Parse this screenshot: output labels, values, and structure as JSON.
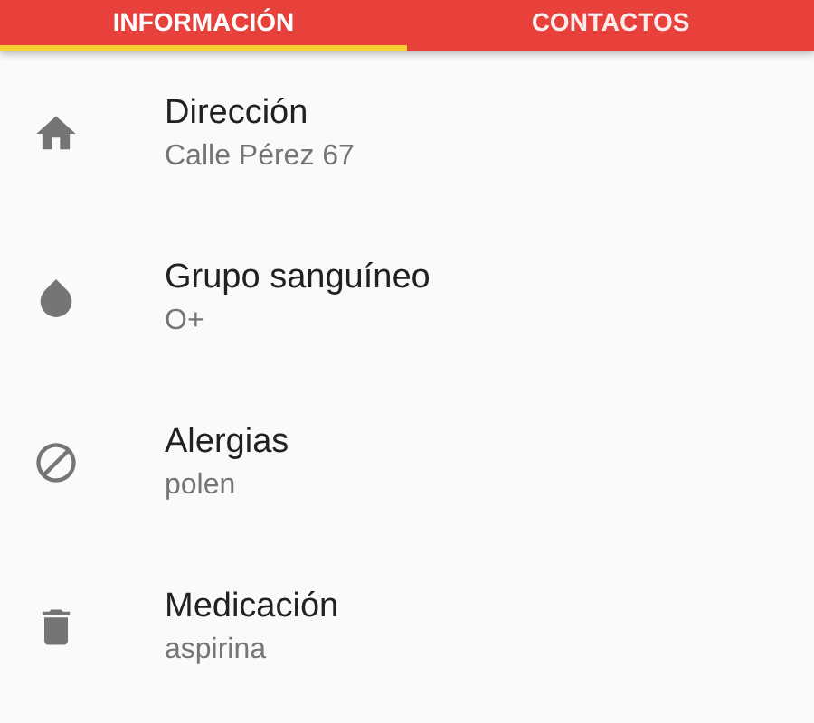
{
  "tabs": [
    {
      "label": "INFORMACIÓN",
      "selected": true
    },
    {
      "label": "CONTACTOS",
      "selected": false
    }
  ],
  "items": [
    {
      "kind": "home",
      "title": "Dirección",
      "value": "Calle Pérez 67"
    },
    {
      "kind": "drop",
      "title": "Grupo sanguíneo",
      "value": "O+"
    },
    {
      "kind": "block",
      "title": "Alergias",
      "value": "polen"
    },
    {
      "kind": "container",
      "title": "Medicación",
      "value": "aspirina"
    }
  ]
}
